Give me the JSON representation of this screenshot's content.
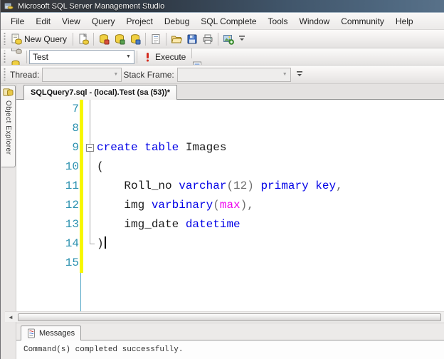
{
  "window": {
    "title": "Microsoft SQL Server Management Studio"
  },
  "menu": {
    "items": [
      "File",
      "Edit",
      "View",
      "Query",
      "Project",
      "Debug",
      "SQL Complete",
      "Tools",
      "Window",
      "Community",
      "Help"
    ]
  },
  "toolbar_standard": {
    "new_query_label": "New Query",
    "items": [
      {
        "type": "button",
        "icon": "new-query-icon",
        "label": true
      },
      {
        "type": "sep"
      },
      {
        "type": "button",
        "icon": "new-text-file-icon"
      },
      {
        "type": "sep"
      },
      {
        "type": "button",
        "icon": "db-engine-query-icon"
      },
      {
        "type": "button",
        "icon": "mdx-query-icon"
      },
      {
        "type": "button",
        "icon": "xmla-query-icon"
      },
      {
        "type": "sep"
      },
      {
        "type": "button",
        "icon": "analysis-query-icon"
      },
      {
        "type": "sep"
      },
      {
        "type": "button",
        "icon": "open-file-icon"
      },
      {
        "type": "button",
        "icon": "save-icon"
      },
      {
        "type": "button",
        "icon": "print-icon"
      },
      {
        "type": "sep"
      },
      {
        "type": "button",
        "icon": "sql-complete-image-icon"
      },
      {
        "type": "button",
        "icon": "toolbar-overflow-icon"
      }
    ]
  },
  "toolbar_sql": {
    "database": "Test",
    "execute_label": "Execute",
    "items_before_combo": [
      {
        "type": "button",
        "icon": "connect-icon"
      },
      {
        "type": "button",
        "icon": "change-connection-icon"
      }
    ],
    "items_after_execute": [
      {
        "type": "button",
        "icon": "debug-play-icon"
      },
      {
        "type": "button",
        "icon": "stop-icon"
      },
      {
        "type": "button",
        "icon": "parse-icon"
      },
      {
        "type": "button",
        "icon": "estimated-plan-icon"
      },
      {
        "type": "button",
        "icon": "query-options-icon"
      },
      {
        "type": "button",
        "icon": "intellisense-icon",
        "toggled": true
      },
      {
        "type": "button",
        "icon": "actual-plan-icon"
      },
      {
        "type": "button",
        "icon": "client-statistics-icon"
      },
      {
        "type": "sep"
      },
      {
        "type": "button",
        "icon": "results-text-icon"
      },
      {
        "type": "button",
        "icon": "results-grid-icon",
        "toggled": true
      },
      {
        "type": "button",
        "icon": "results-file-icon"
      },
      {
        "type": "sep"
      },
      {
        "type": "button",
        "icon": "comment-icon"
      },
      {
        "type": "button",
        "icon": "uncomment-icon"
      },
      {
        "type": "sep"
      },
      {
        "type": "button",
        "icon": "decrease-indent-icon"
      },
      {
        "type": "button",
        "icon": "increase-indent-icon"
      }
    ]
  },
  "toolbar_debug": {
    "thread_label": "Thread:",
    "stack_frame_label": "Stack Frame:"
  },
  "object_explorer": {
    "label": "Object Explorer"
  },
  "document": {
    "tab_label": "SQLQuery7.sql - (local).Test (sa (53))*"
  },
  "editor": {
    "colors": {
      "kw": "#0000e6",
      "id": "#1a1a1a",
      "gr": "#6f6f6f",
      "mg": "#ee00ee",
      "line_number": "#2b91af",
      "changed_bar": "#f7f700"
    },
    "lines": [
      {
        "num": "7",
        "tokens": []
      },
      {
        "num": "8",
        "tokens": []
      },
      {
        "num": "9",
        "fold": "start",
        "tokens": [
          {
            "t": "create table",
            "c": "kw"
          },
          {
            "t": " Images",
            "c": "id"
          }
        ]
      },
      {
        "num": "10",
        "tokens": [
          {
            "t": "(",
            "c": "id"
          }
        ]
      },
      {
        "num": "11",
        "tokens": [
          {
            "t": "    Roll_no ",
            "c": "id"
          },
          {
            "t": "varchar",
            "c": "kw"
          },
          {
            "t": "(12)",
            "c": "gr"
          },
          {
            "t": " ",
            "c": "id"
          },
          {
            "t": "primary key",
            "c": "kw"
          },
          {
            "t": ",",
            "c": "gr"
          }
        ]
      },
      {
        "num": "12",
        "tokens": [
          {
            "t": "    img ",
            "c": "id"
          },
          {
            "t": "varbinary",
            "c": "kw"
          },
          {
            "t": "(",
            "c": "gr"
          },
          {
            "t": "max",
            "c": "mg"
          },
          {
            "t": "),",
            "c": "gr"
          }
        ]
      },
      {
        "num": "13",
        "tokens": [
          {
            "t": "    img_date ",
            "c": "id"
          },
          {
            "t": "datetime",
            "c": "kw"
          }
        ]
      },
      {
        "num": "14",
        "fold": "end",
        "caret": true,
        "tokens": [
          {
            "t": ")",
            "c": "id"
          }
        ]
      },
      {
        "num": "15",
        "tokens": []
      }
    ]
  },
  "messages": {
    "tab_label": "Messages",
    "text": "Command(s) completed successfully."
  }
}
